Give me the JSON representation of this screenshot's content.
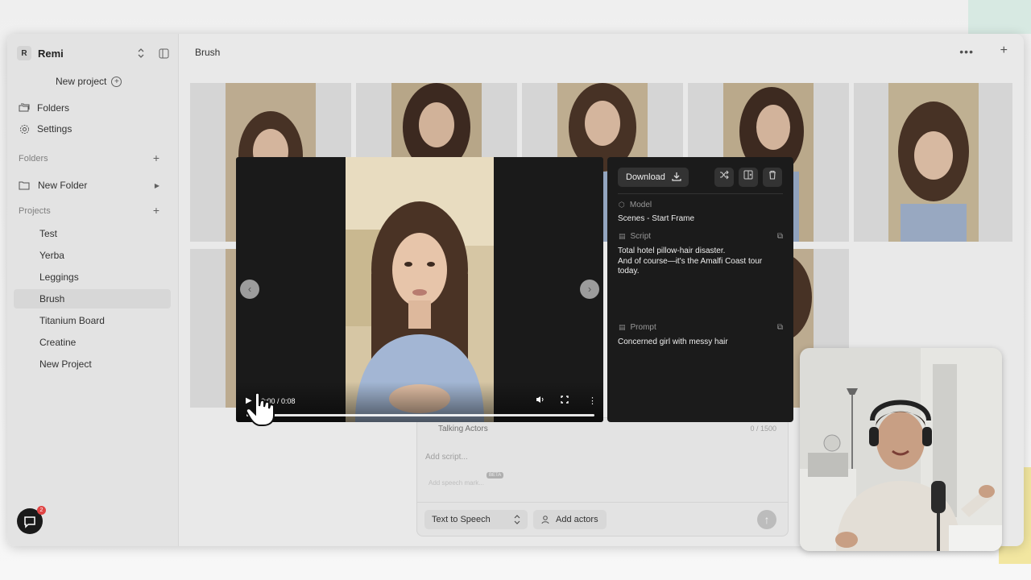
{
  "workspace": {
    "initial": "R",
    "name": "Remi"
  },
  "sidebar": {
    "new_project_label": "New project",
    "nav": [
      {
        "label": "Folders",
        "icon": "folders-icon"
      },
      {
        "label": "Settings",
        "icon": "gear-icon"
      }
    ],
    "folders_heading": "Folders",
    "folders": [
      {
        "label": "New Folder"
      }
    ],
    "projects_heading": "Projects",
    "projects": [
      {
        "label": "Test"
      },
      {
        "label": "Yerba"
      },
      {
        "label": "Leggings"
      },
      {
        "label": "Brush",
        "active": true
      },
      {
        "label": "Titanium Board"
      },
      {
        "label": "Creatine"
      },
      {
        "label": "New Project"
      }
    ]
  },
  "header": {
    "title": "Brush"
  },
  "composer": {
    "actors_mode": "Talking Actors",
    "char_count": "0 / 1500",
    "script_placeholder": "Add script...",
    "beta_badge": "BETA",
    "speech_hint": "Add speech mark...",
    "tts_mode": "Text to Speech",
    "add_actors_label": "Add actors"
  },
  "chat": {
    "badge_count": "2"
  },
  "video": {
    "time": "0:00 / 0:08",
    "progress": 0
  },
  "panel": {
    "download_label": "Download",
    "model_label": "Model",
    "model_value": "Scenes - Start Frame",
    "script_label": "Script",
    "script_line1": "Total hotel pillow-hair disaster.",
    "script_line2": "And of course—it's the Amalfi Coast tour today.",
    "prompt_label": "Prompt",
    "prompt_value": "Concerned girl with messy hair"
  },
  "colors": {
    "accent_dark": "#1b1b1b",
    "active_item": "#e6e6e6"
  }
}
